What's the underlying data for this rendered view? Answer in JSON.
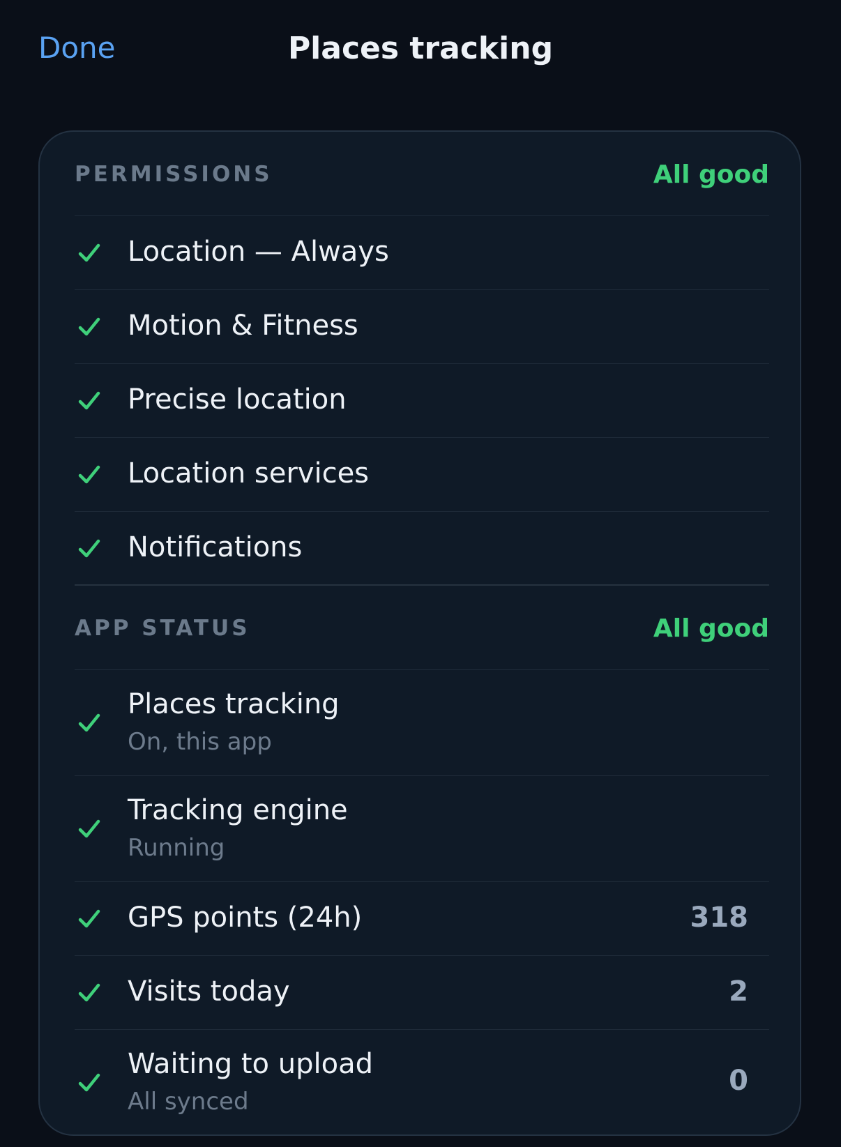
{
  "nav": {
    "done_label": "Done",
    "title": "Places tracking"
  },
  "colors": {
    "background": "#0a0f18",
    "card": "#0f1a27",
    "accent_blue": "#5aa2f2",
    "ok_green": "#3fd07a",
    "muted_text": "#6d7b8c"
  },
  "permissions": {
    "label": "PERMISSIONS",
    "status": "All good",
    "items": [
      {
        "title": "Location — Always",
        "icon": "check-icon"
      },
      {
        "title": "Motion & Fitness",
        "icon": "check-icon"
      },
      {
        "title": "Precise location",
        "icon": "check-icon"
      },
      {
        "title": "Location services",
        "icon": "check-icon"
      },
      {
        "title": "Notifications",
        "icon": "check-icon"
      }
    ]
  },
  "app_status": {
    "label": "APP STATUS",
    "status": "All good",
    "items": [
      {
        "title": "Places tracking",
        "subtitle": "On, this app",
        "icon": "check-icon"
      },
      {
        "title": "Tracking engine",
        "subtitle": "Running",
        "icon": "check-icon"
      },
      {
        "title": "GPS points (24h)",
        "value": "318",
        "icon": "check-icon"
      },
      {
        "title": "Visits today",
        "value": "2",
        "icon": "check-icon"
      },
      {
        "title": "Waiting to upload",
        "subtitle": "All synced",
        "value": "0",
        "icon": "check-icon"
      }
    ]
  }
}
